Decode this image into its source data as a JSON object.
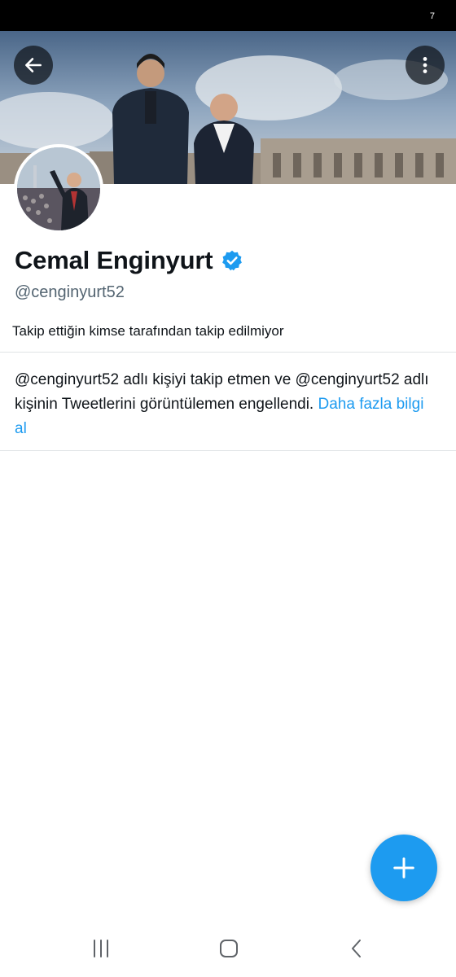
{
  "status_bar": {
    "indicator": "7"
  },
  "header": {
    "back_icon": "arrow-left-icon",
    "more_icon": "more-vertical-icon"
  },
  "profile": {
    "display_name": "Cemal Enginyurt",
    "verified": true,
    "verified_icon": "verified-badge-icon",
    "handle": "@cenginyurt52",
    "follow_context": "Takip ettiğin kimse tarafından takip edilmiyor"
  },
  "blocked_notice": {
    "text": "@cenginyurt52 adlı kişiyi takip etmen ve @cenginyurt52 adlı kişinin Tweetlerini görüntülemen engellendi. ",
    "link_text": "Daha fazla bilgi al"
  },
  "fab": {
    "icon": "plus-icon"
  },
  "nav_bar": {
    "recents_icon": "recent-apps-icon",
    "home_icon": "home-icon",
    "back_icon": "back-chevron-icon"
  },
  "colors": {
    "accent": "#1d9bf0",
    "text_primary": "#0f1419",
    "text_secondary": "#536471",
    "divider": "#dfe3e6"
  }
}
